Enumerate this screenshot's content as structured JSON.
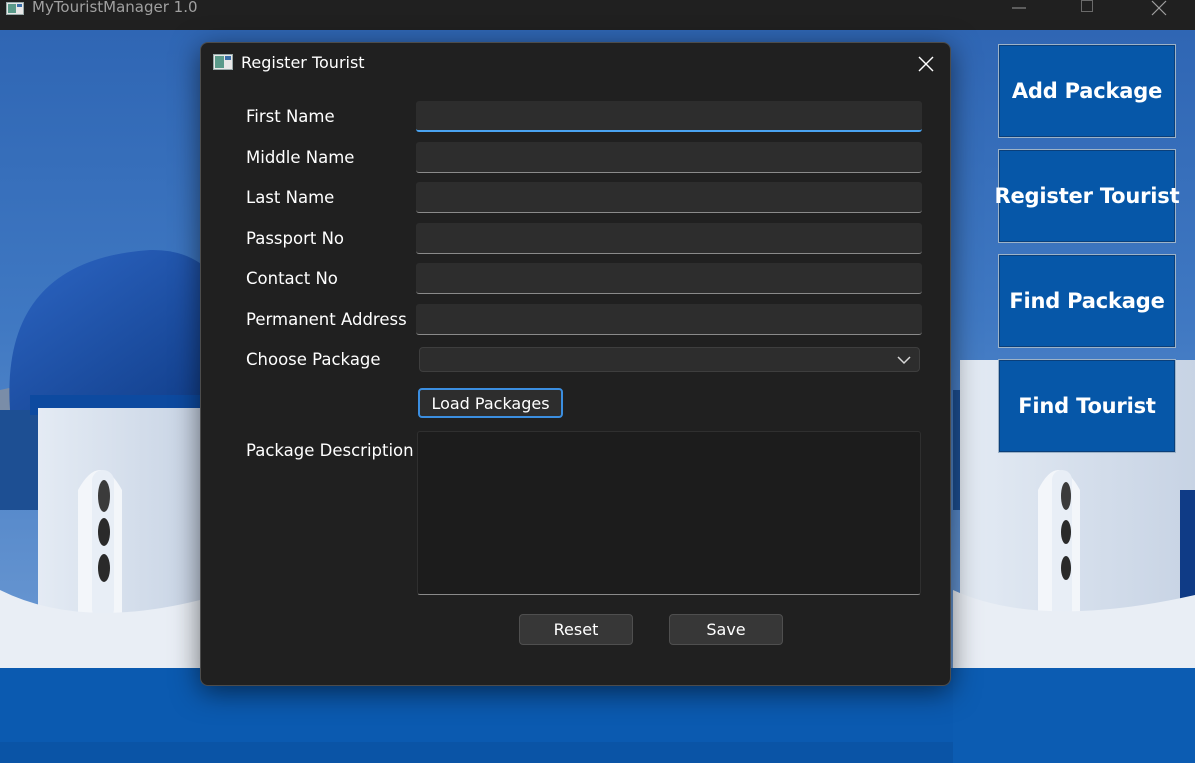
{
  "app": {
    "title": "MyTouristManager 1.0"
  },
  "nav": {
    "add_package": "Add Package",
    "register_tourist": "Register Tourist",
    "find_package": "Find Package",
    "find_tourist": "Find Tourist"
  },
  "dialog": {
    "title": "Register Tourist",
    "fields": {
      "first_name": {
        "label": "First Name",
        "value": ""
      },
      "middle_name": {
        "label": "Middle Name",
        "value": ""
      },
      "last_name": {
        "label": "Last Name",
        "value": ""
      },
      "passport_no": {
        "label": "Passport No",
        "value": ""
      },
      "contact_no": {
        "label": "Contact No",
        "value": ""
      },
      "permanent_address": {
        "label": "Permanent Address",
        "value": ""
      }
    },
    "choose_package": {
      "label": "Choose Package",
      "selected": ""
    },
    "load_packages_label": "Load Packages",
    "package_description": {
      "label": "Package Description",
      "value": ""
    },
    "reset_label": "Reset",
    "save_label": "Save"
  },
  "colors": {
    "accent": "#3b8ee0",
    "nav_button_bg": "#0657a8",
    "dialog_bg": "#202020",
    "input_bg": "#2d2d2d"
  },
  "icons": {
    "app": "app-window-icon",
    "minimize": "minimize-icon",
    "maximize": "maximize-icon",
    "close": "close-icon",
    "combo": "chevron-down-icon"
  }
}
